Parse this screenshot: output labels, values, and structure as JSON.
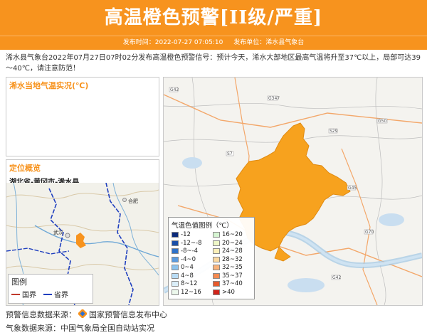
{
  "header": {
    "title": "高温橙色预警[II级/严重]",
    "bg_color": "#f7931e"
  },
  "meta": {
    "publish_time": "发布时间：2022-07-27 07:05:10",
    "publisher": "发布单位：浠水县气象台"
  },
  "signal_text": "浠水县气象台2022年07月27日07时02分发布高温橙色预警信号：预计今天，浠水大部地区最高气温将升至37℃以上，局部可达39～40℃，请注意防范！",
  "temp_panel": {
    "title": "浠水当地气温实况(℃)"
  },
  "location": {
    "title": "定位概览",
    "name": "湖北省-黄冈市-浠水县",
    "labels": {
      "hefei": "合肥",
      "wuhan": "武汉"
    },
    "legend": {
      "title": "图例",
      "national": "国界",
      "provincial": "省界"
    }
  },
  "temp_legend": {
    "title": "气温色值图例（℃）",
    "items": [
      {
        "label": "-12",
        "color": "#0b2a7a"
      },
      {
        "label": "16~20",
        "color": "#d6f5d2"
      },
      {
        "label": "-12~-8",
        "color": "#1a4fa8"
      },
      {
        "label": "20~24",
        "color": "#eef7c7"
      },
      {
        "label": "-8~-4",
        "color": "#2f72c9"
      },
      {
        "label": "24~28",
        "color": "#fcefb8"
      },
      {
        "label": "-4~0",
        "color": "#5a9be0"
      },
      {
        "label": "28~32",
        "color": "#fcd9a0"
      },
      {
        "label": "0~4",
        "color": "#8cc3ee"
      },
      {
        "label": "32~35",
        "color": "#f9b27a"
      },
      {
        "label": "4~8",
        "color": "#b8dcf5"
      },
      {
        "label": "35~37",
        "color": "#f58a50"
      },
      {
        "label": "8~12",
        "color": "#daeef9"
      },
      {
        "label": "37~40",
        "color": "#e65a2c"
      },
      {
        "label": "12~16",
        "color": "#ecf8ec"
      },
      {
        "label": ">40",
        "color": "#d1241b"
      }
    ]
  },
  "map_labels": {
    "road_codes": [
      "G42",
      "G50",
      "S29",
      "G45",
      "S7",
      "G347",
      "G70",
      "G42"
    ]
  },
  "footer": {
    "warning_source_label": "预警信息数据来源：",
    "warning_source": "国家预警信息发布中心",
    "weather_source_label": "气象数据来源：",
    "weather_source": "中国气象局全国自动站实况"
  },
  "colors": {
    "accent": "#f7931e",
    "region_fill": "#f7a21e",
    "national_border": "#c0392b",
    "provincial_border": "#1f3fbf"
  }
}
